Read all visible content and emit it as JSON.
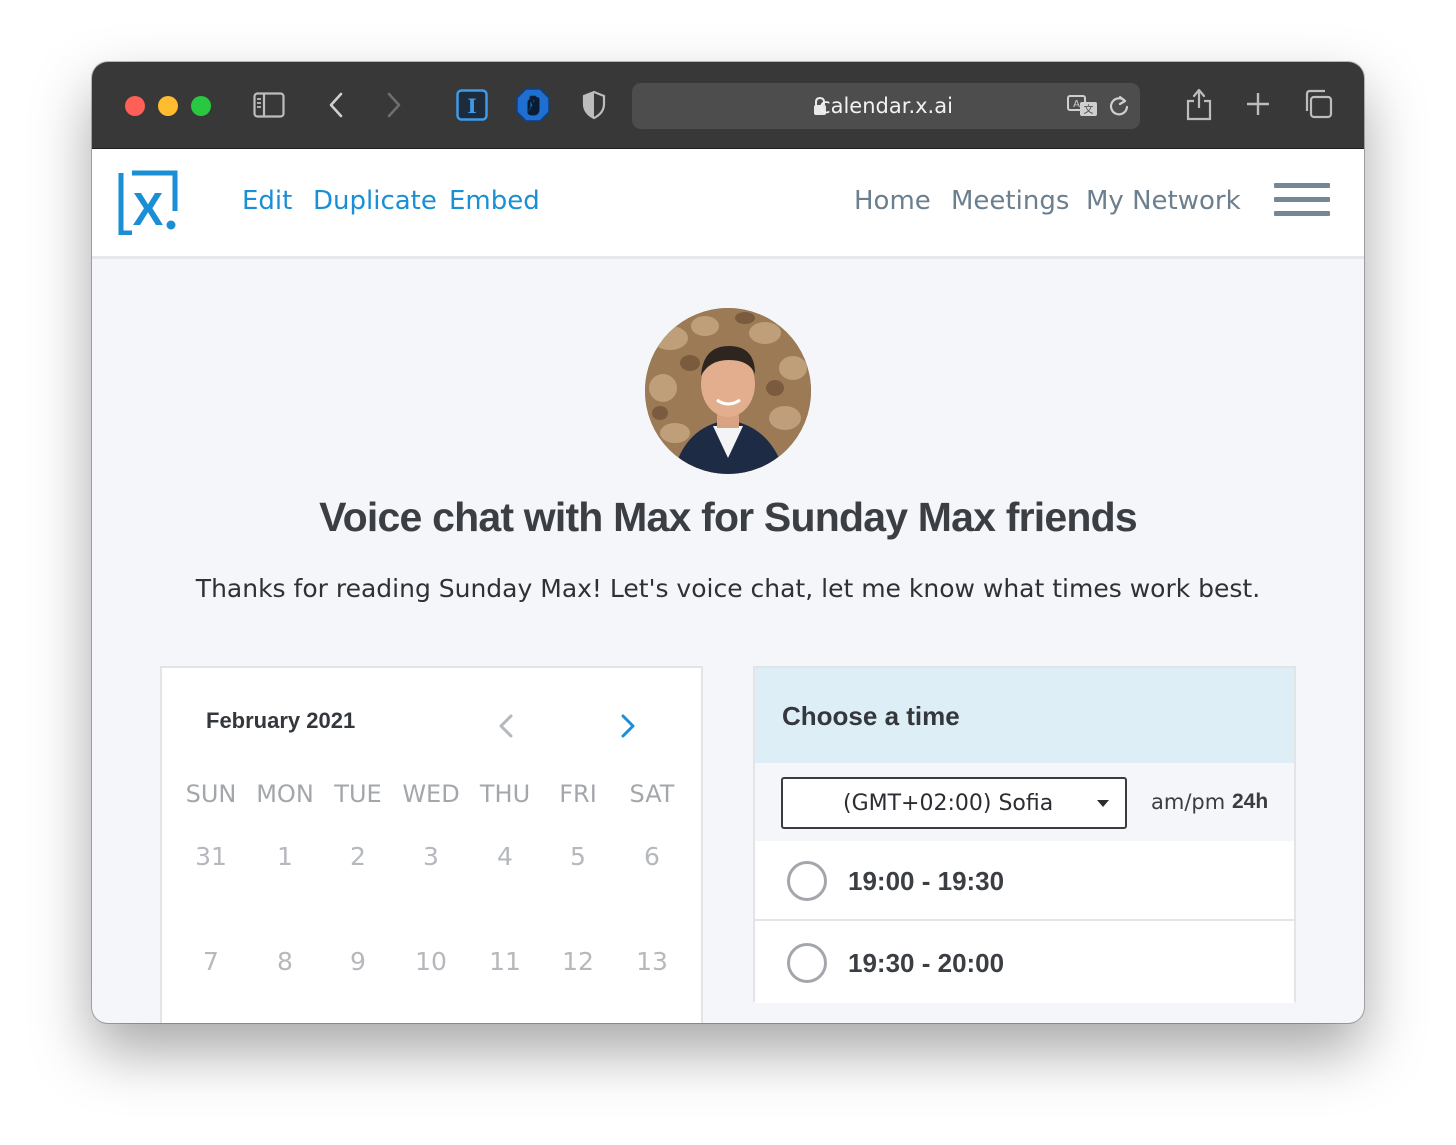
{
  "browser": {
    "url": "calendar.x.ai"
  },
  "nav": {
    "left_links": [
      "Edit",
      "Duplicate",
      "Embed"
    ],
    "right_links": [
      "Home",
      "Meetings",
      "My Network"
    ]
  },
  "page": {
    "title": "Voice chat with Max for Sunday Max friends",
    "subtitle": "Thanks for reading Sunday Max! Let's voice chat, let me know what times work best."
  },
  "calendar": {
    "month": "February 2021",
    "weekdays": [
      "SUN",
      "MON",
      "TUE",
      "WED",
      "THU",
      "FRI",
      "SAT"
    ],
    "weeks": [
      [
        "31",
        "1",
        "2",
        "3",
        "4",
        "5",
        "6"
      ],
      [
        "7",
        "8",
        "9",
        "10",
        "11",
        "12",
        "13"
      ]
    ]
  },
  "time_panel": {
    "title": "Choose a time",
    "timezone": "(GMT+02:00) Sofia",
    "format_ampm": "am/pm",
    "format_24h": "24h",
    "slots": [
      "19:00 - 19:30",
      "19:30 - 20:00"
    ]
  },
  "colors": {
    "accent_blue": "#1a8fd6",
    "nav_gray": "#6c7f8e",
    "panel_header": "#deeef7"
  }
}
